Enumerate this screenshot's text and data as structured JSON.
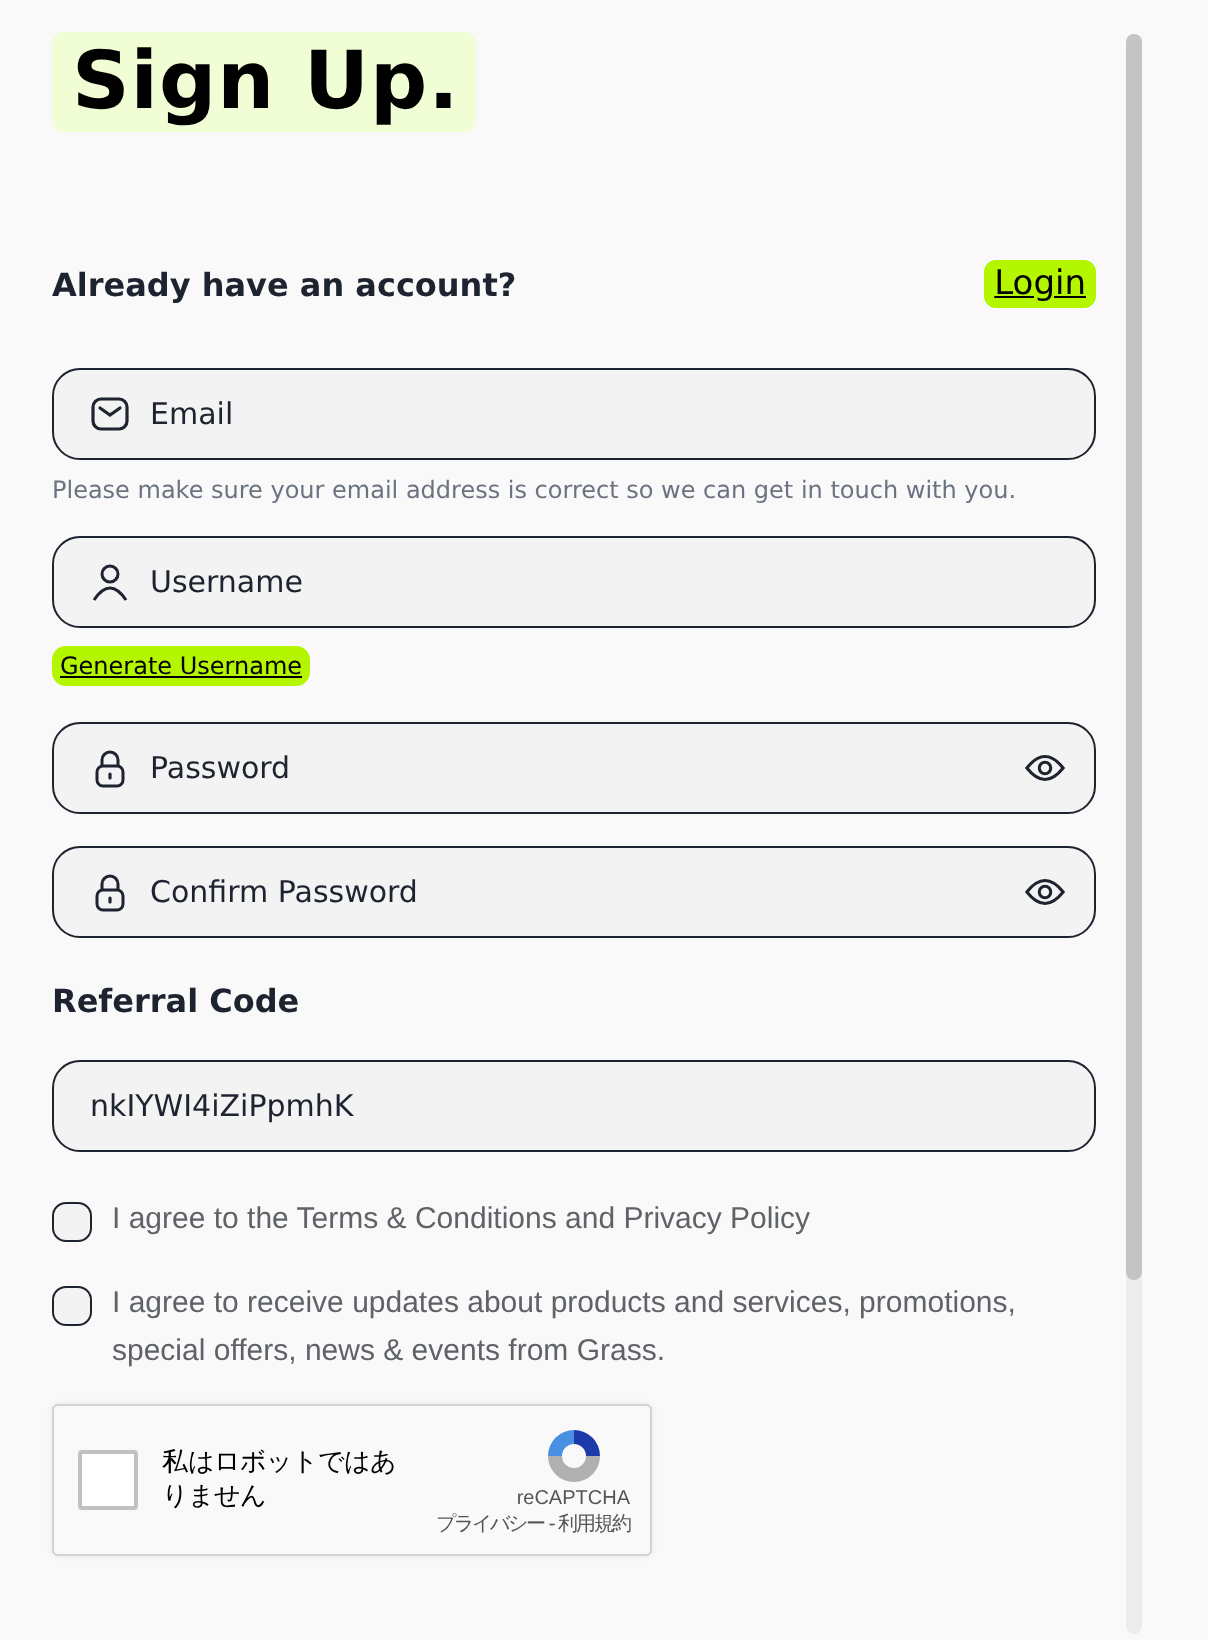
{
  "title": "Sign Up.",
  "login_prompt": {
    "text": "Already have an account?",
    "link": "Login"
  },
  "fields": [
    {
      "kind": "email",
      "placeholder": "Email",
      "reveal": false,
      "hint": "Please make sure your email address is correct so we can get in touch with you."
    },
    {
      "kind": "user",
      "placeholder": "Username",
      "reveal": false,
      "action": "Generate Username"
    },
    {
      "kind": "lock",
      "placeholder": "Password",
      "reveal": true
    },
    {
      "kind": "lock",
      "placeholder": "Confirm Password",
      "reveal": true
    }
  ],
  "referral": {
    "label": "Referral Code",
    "value": "nkIYWI4iZiPpmhK"
  },
  "agreements": [
    {
      "text": "I agree to the Terms & Conditions and Privacy Policy",
      "checked": false
    },
    {
      "text": "I agree to receive updates about products and services, promotions, special offers, news & events from Grass.",
      "checked": false
    }
  ],
  "captcha": {
    "label": "私はロボットではありません",
    "checked": false,
    "brand": "reCAPTCHA",
    "links": "プライバシー - 利用規約"
  }
}
